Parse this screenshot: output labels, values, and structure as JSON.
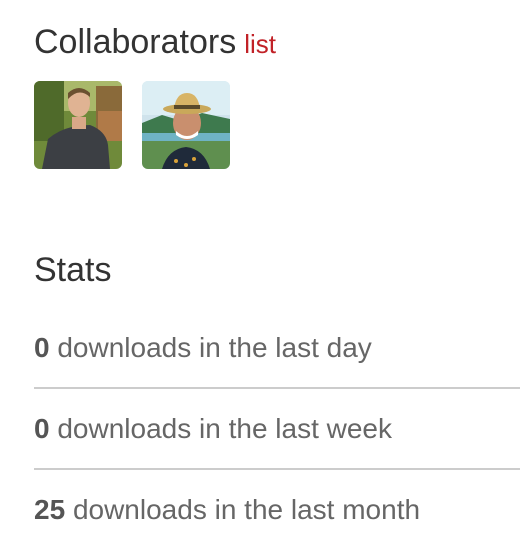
{
  "collaborators": {
    "title": "Collaborators",
    "list_link": "list",
    "users": [
      {
        "avatar": "user-avatar-1"
      },
      {
        "avatar": "user-avatar-2"
      }
    ]
  },
  "stats": {
    "title": "Stats",
    "items": [
      {
        "count": "0",
        "label": "downloads in the last day"
      },
      {
        "count": "0",
        "label": "downloads in the last week"
      },
      {
        "count": "25",
        "label": "downloads in the last month"
      }
    ]
  },
  "colors": {
    "link": "#c12127",
    "heading": "#333333",
    "text": "#666666",
    "divider": "#cccccc"
  }
}
